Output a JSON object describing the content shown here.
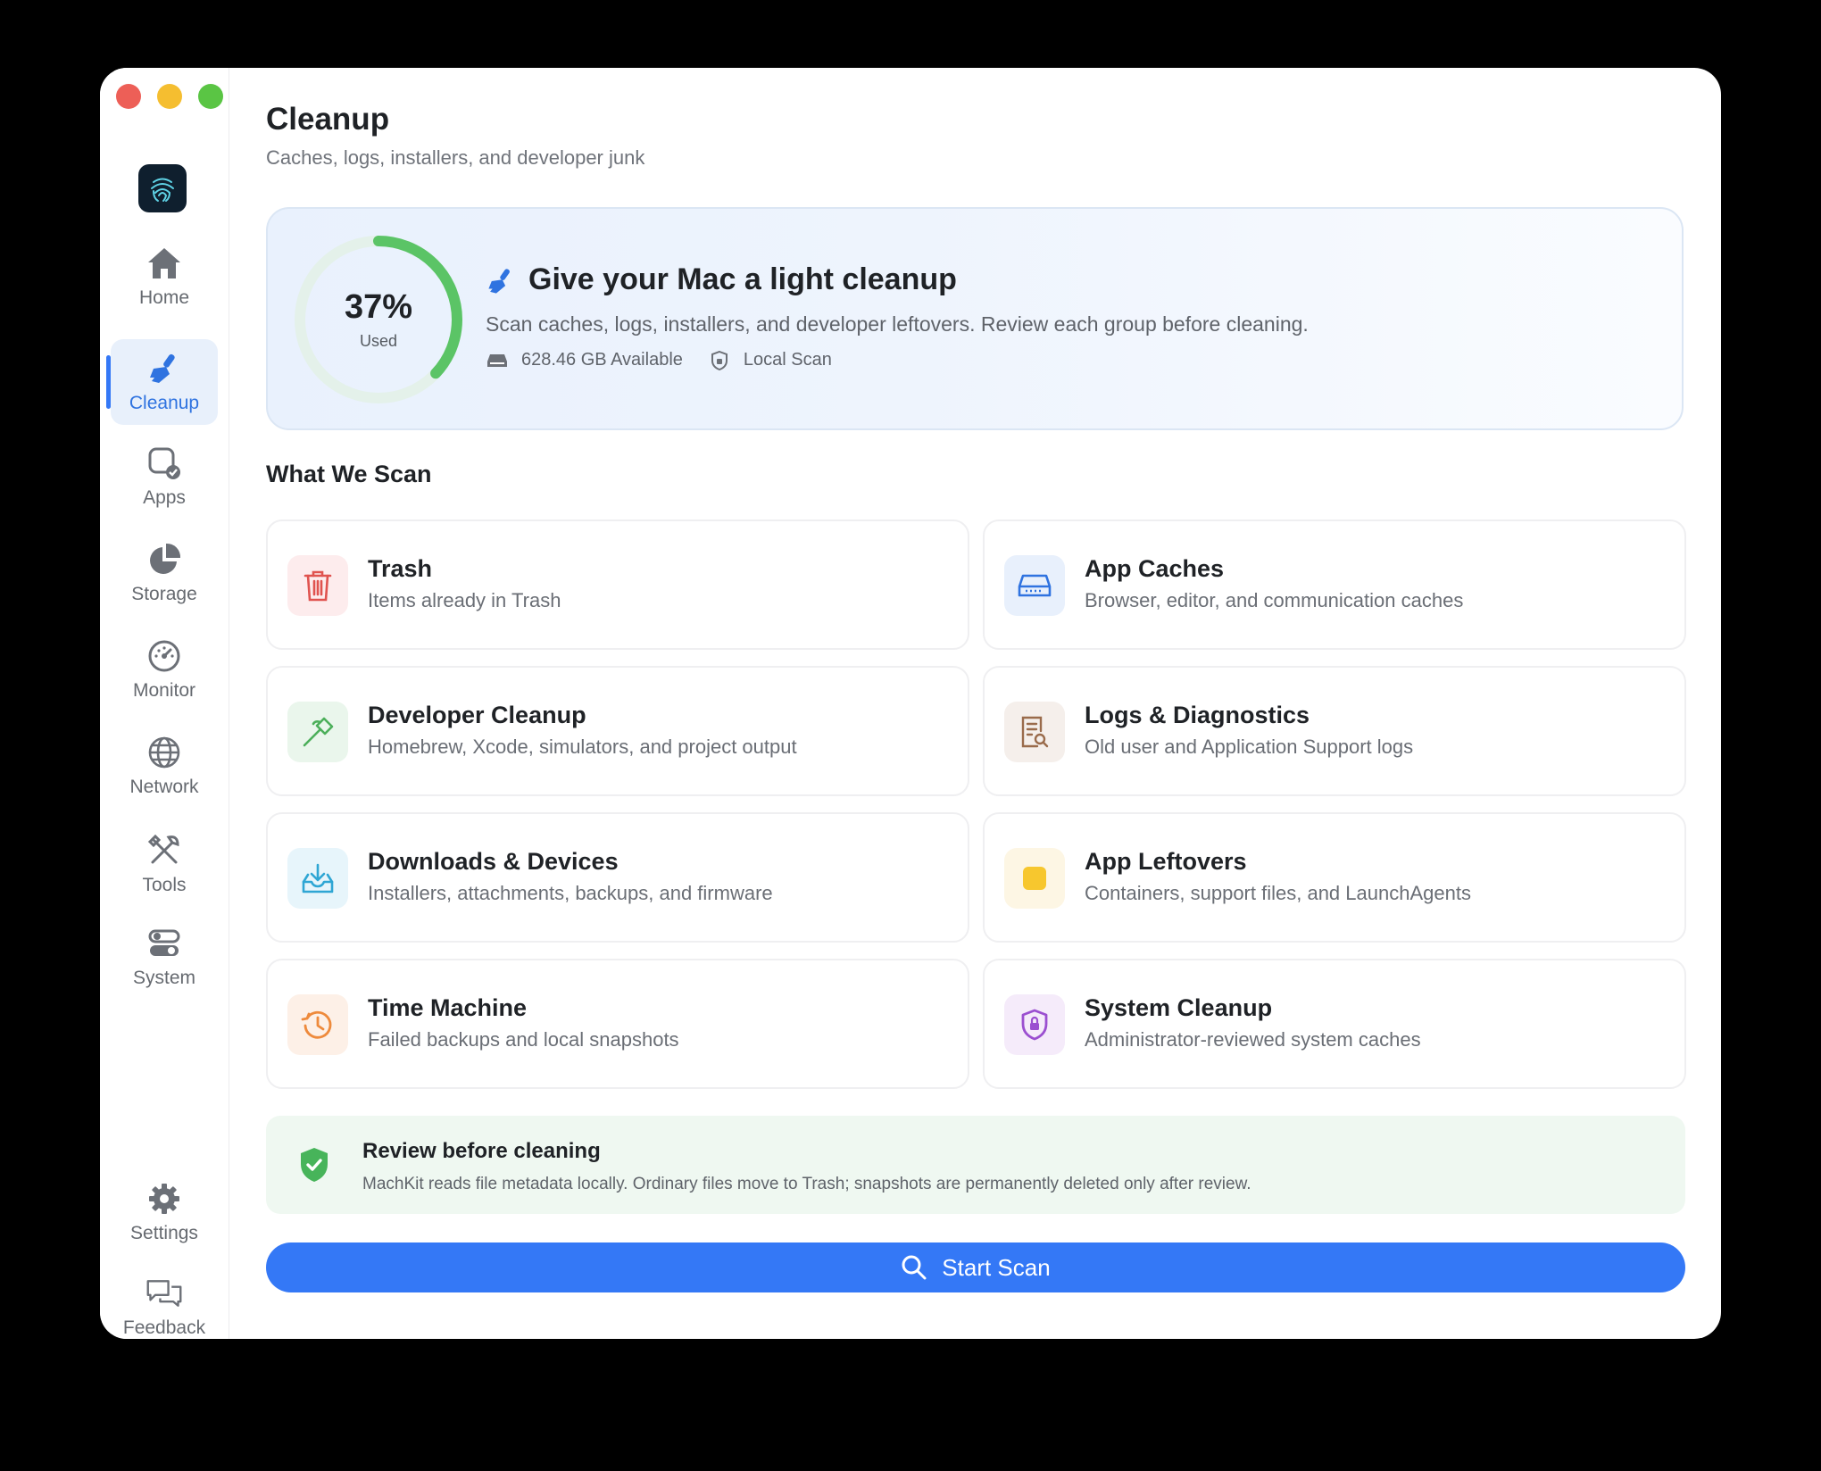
{
  "sidebar": {
    "items": [
      {
        "label": "Home",
        "icon": "house-icon"
      },
      {
        "label": "Cleanup",
        "icon": "broom-icon",
        "active": true
      },
      {
        "label": "Apps",
        "icon": "apps-icon"
      },
      {
        "label": "Storage",
        "icon": "pie-chart-icon"
      },
      {
        "label": "Monitor",
        "icon": "gauge-icon"
      },
      {
        "label": "Network",
        "icon": "globe-icon"
      },
      {
        "label": "Tools",
        "icon": "tools-icon"
      },
      {
        "label": "System",
        "icon": "toggles-icon"
      }
    ],
    "bottom": [
      {
        "label": "Settings",
        "icon": "gear-icon"
      },
      {
        "label": "Feedback",
        "icon": "chat-bubbles-icon"
      }
    ]
  },
  "page": {
    "title": "Cleanup",
    "subtitle": "Caches, logs, installers, and developer junk"
  },
  "hero": {
    "used_percent_label": "37%",
    "used_fraction": 0.37,
    "used_label": "Used",
    "title": "Give your Mac a light cleanup",
    "description": "Scan caches, logs, installers, and developer leftovers. Review each group before cleaning.",
    "available": "628.46 GB Available",
    "scan_mode": "Local Scan"
  },
  "section_title": "What We Scan",
  "cards": [
    {
      "title": "Trash",
      "subtitle": "Items already in Trash",
      "icon": "trash-icon"
    },
    {
      "title": "App Caches",
      "subtitle": "Browser, editor, and communication caches",
      "icon": "drive-icon"
    },
    {
      "title": "Developer Cleanup",
      "subtitle": "Homebrew, Xcode, simulators, and project output",
      "icon": "hammer-icon"
    },
    {
      "title": "Logs & Diagnostics",
      "subtitle": "Old user and Application Support logs",
      "icon": "log-search-icon"
    },
    {
      "title": "Downloads & Devices",
      "subtitle": "Installers, attachments, backups, and firmware",
      "icon": "tray-download-icon"
    },
    {
      "title": "App Leftovers",
      "subtitle": "Containers, support files, and LaunchAgents",
      "icon": "square-icon"
    },
    {
      "title": "Time Machine",
      "subtitle": "Failed backups and local snapshots",
      "icon": "clock-history-icon"
    },
    {
      "title": "System Cleanup",
      "subtitle": "Administrator-reviewed system caches",
      "icon": "lock-shield-icon"
    }
  ],
  "review": {
    "title": "Review before cleaning",
    "description": "MachKit reads file metadata locally. Ordinary files move to Trash; snapshots are permanently deleted only after review."
  },
  "scan_button": {
    "label": "Start Scan"
  },
  "colors": {
    "accent": "#3478f6",
    "gauge": "#5bc466",
    "review_bg": "#eff8f1"
  }
}
